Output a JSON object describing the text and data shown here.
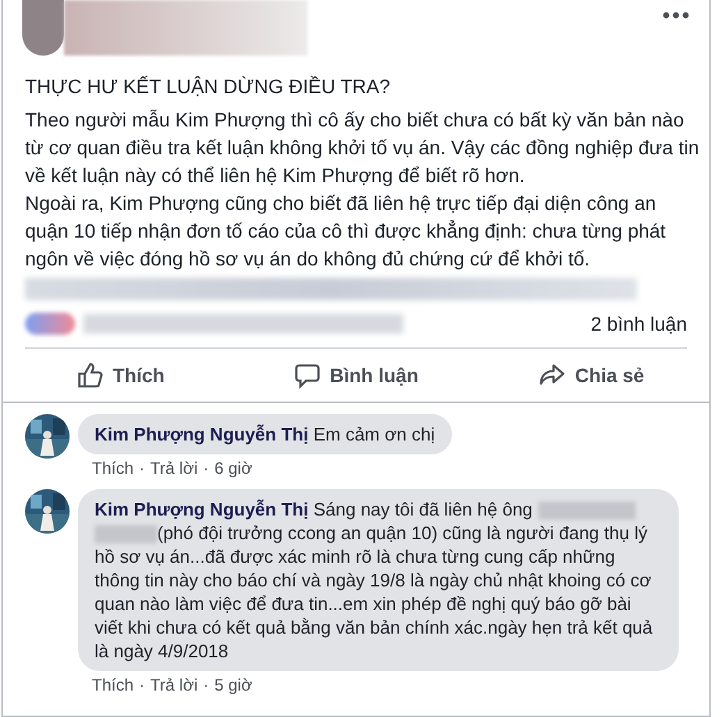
{
  "post": {
    "title": "THỰC HƯ KẾT LUẬN DỪNG ĐIỀU TRA?",
    "paragraphs": [
      "Theo người mẫu Kim Phượng thì cô ấy cho biết chưa có bất kỳ văn bản nào từ cơ quan điều tra kết luận không khởi tố vụ án. Vậy các đồng nghiệp đưa tin về kết luận này có thể liên hệ Kim Phượng để biết rõ hơn.",
      "Ngoài ra, Kim Phượng cũng cho biết đã liên hệ trực tiếp đại diện công an quận 10 tiếp nhận đơn tố cáo của cô thì được khẳng định: chưa từng phát ngôn về việc đóng hồ sơ vụ án do không đủ chứng cứ để khởi tố."
    ],
    "comment_count": "2 bình luận"
  },
  "actions": [
    {
      "kind": "like",
      "label": "Thích"
    },
    {
      "kind": "comment",
      "label": "Bình luận"
    },
    {
      "kind": "share",
      "label": "Chia sẻ"
    }
  ],
  "comments": [
    {
      "author": "Kim Phượng Nguyễn Thị",
      "segments": [
        {
          "kind": "text",
          "text": "Em cảm ơn chị"
        }
      ],
      "meta": [
        "Thích",
        "Trả lời",
        "6 giờ"
      ],
      "separator": "·"
    },
    {
      "author": "Kim Phượng Nguyễn Thị",
      "segments": [
        {
          "kind": "text",
          "text": "Sáng nay tôi đã liên hệ ông"
        },
        {
          "kind": "redacted"
        },
        {
          "kind": "line_start_redacted"
        },
        {
          "kind": "line",
          "text": "(phó đội trưởng ccong an quận 10) cũng là người đang thụ lý"
        },
        {
          "kind": "block",
          "text": "hồ sơ vụ án...đã được xác minh rõ là chưa từng cung cấp những thông tin này cho báo chí và ngày 19/8 là ngày chủ nhật khoing có cơ quan nào làm việc để đưa tin...em xin phép đề nghị quý báo gỡ bài viết khi chưa có kết quả bằng văn bản chính xác.ngày hẹn trả kết quả là ngày 4/9/2018"
        }
      ],
      "meta": [
        "Thích",
        "Trả lời",
        "5 giờ"
      ],
      "separator": "·"
    }
  ]
}
